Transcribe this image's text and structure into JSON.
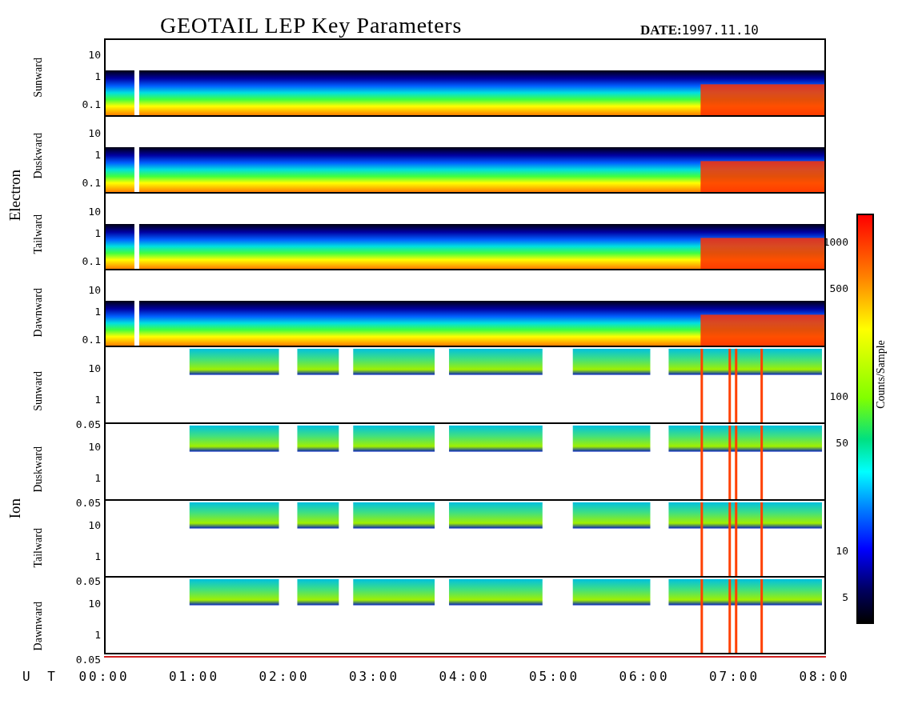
{
  "title": "GEOTAIL LEP Key Parameters",
  "date": {
    "label": "DATE:",
    "value": "1997.11.10"
  },
  "groups": [
    {
      "label": "Electron",
      "kind": "electron",
      "panels": [
        {
          "label": "Sunward",
          "ticks": [
            "10",
            "1",
            "0.1"
          ]
        },
        {
          "label": "Duskward",
          "ticks": [
            "10",
            "1",
            "0.1"
          ]
        },
        {
          "label": "Tailward",
          "ticks": [
            "10",
            "1",
            "0.1"
          ]
        },
        {
          "label": "Dawnward",
          "ticks": [
            "10",
            "1",
            "0.1"
          ]
        }
      ]
    },
    {
      "label": "Ion",
      "kind": "ion",
      "panels": [
        {
          "label": "Sunward",
          "ticks": [
            "10",
            "1",
            "0.05"
          ]
        },
        {
          "label": "Duskward",
          "ticks": [
            "10",
            "1",
            "0.05"
          ]
        },
        {
          "label": "Tailward",
          "ticks": [
            "10",
            "1",
            "0.05"
          ]
        },
        {
          "label": "Dawnward",
          "ticks": [
            "10",
            "1",
            "0.05"
          ]
        }
      ]
    }
  ],
  "x_axis": {
    "label": "U T",
    "ticks": [
      "00:00",
      "01:00",
      "02:00",
      "03:00",
      "04:00",
      "05:00",
      "06:00",
      "07:00",
      "08:00"
    ]
  },
  "colorbar": {
    "title": "Counts/Sample",
    "ticks": [
      "1000",
      "500",
      "100",
      "50",
      "10",
      "5"
    ]
  }
}
